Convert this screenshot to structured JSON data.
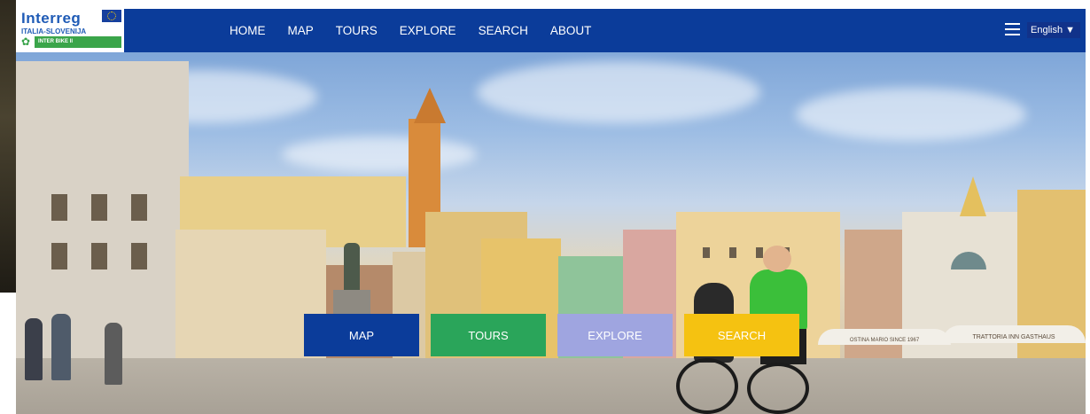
{
  "logo": {
    "brand": "Interreg",
    "region": "ITALIA-SLOVENIJA",
    "project": "INTER BIKE II"
  },
  "nav": {
    "items": [
      "HOME",
      "MAP",
      "TOURS",
      "EXPLORE",
      "SEARCH",
      "ABOUT"
    ]
  },
  "language": {
    "selected": "English ▼"
  },
  "hero": {
    "buttons": [
      {
        "label": "MAP",
        "color": "#0b3c9a"
      },
      {
        "label": "TOURS",
        "color": "#2aa55a"
      },
      {
        "label": "EXPLORE",
        "color": "#9fa5e0"
      },
      {
        "label": "SEARCH",
        "color": "#f5c211"
      }
    ],
    "signs": [
      "TRATTORIA",
      "INN",
      "GASTHAUS",
      "OSTINA MARIO SINCE 1967"
    ]
  },
  "colors": {
    "header_bg": "#0b3c9a",
    "accent_green": "#2aa55a"
  }
}
